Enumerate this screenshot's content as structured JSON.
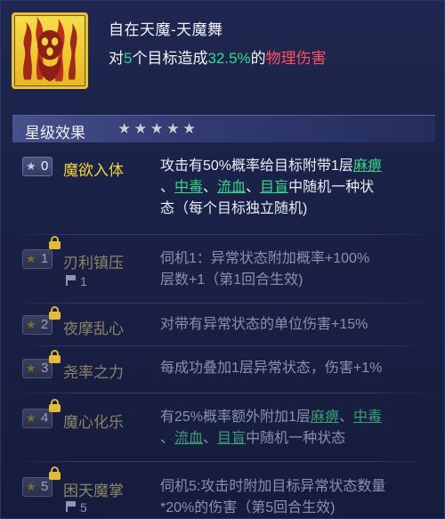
{
  "skill": {
    "title": "自在天魔-天魔舞",
    "desc_prefix": "对",
    "target_count": "5",
    "desc_mid": "个目标造成",
    "damage_percent": "32.5%",
    "desc_of": "的",
    "damage_type": "物理伤害",
    "icon": "ghost-flame-icon"
  },
  "section": {
    "title": "星级效果",
    "star_count": 5
  },
  "rows": [
    {
      "level": "0",
      "name": "魔欲入体",
      "locked": false,
      "desc": {
        "line1_prefix": "攻击有50%概率给目标附带1层",
        "kw1": "麻痹",
        "sep1": "、",
        "kw2": "中毒",
        "sep2": "、",
        "kw3": "流血",
        "sep3": "、",
        "kw4": "目盲",
        "line2_suffix": "中随机一种状",
        "line3": "态（每个目标独立随机)"
      }
    },
    {
      "level": "1",
      "name": "刃利镇压",
      "locked": true,
      "flag_value": "1",
      "desc": {
        "line1": "伺机1：异常状态附加概率+100%",
        "line2": "层数+1（第1回合生效)"
      }
    },
    {
      "level": "2",
      "name": "夜摩乱心",
      "locked": true,
      "desc": {
        "line1": "对带有异常状态的单位伤害+15%"
      }
    },
    {
      "level": "3",
      "name": "尧率之力",
      "locked": true,
      "desc": {
        "line1": "每成功叠加1层异常状态，伤害+1%"
      }
    },
    {
      "level": "4",
      "name": "魔心化乐",
      "locked": true,
      "desc": {
        "line1_prefix": "有25%概率额外附加1层",
        "kw1": "麻痹",
        "sep1": "、",
        "kw2": "中毒",
        "sep0": "、",
        "kw3": "流血",
        "sep2": "、",
        "kw4": "目盲",
        "line2_suffix": "中随机一种状态"
      }
    },
    {
      "level": "5",
      "name": "困天魔掌",
      "locked": true,
      "flag_value": "5",
      "desc": {
        "line1": "伺机5:攻击时附加目标异常状态数量",
        "line2": "*20%的伤害（第5回合生效)"
      }
    }
  ],
  "colors": {
    "background": "#171d3a",
    "highlight_green": "#35d98a",
    "damage_red": "#ff5164",
    "active_name": "#f2d23e",
    "icon_gold": "#e9c23a"
  }
}
